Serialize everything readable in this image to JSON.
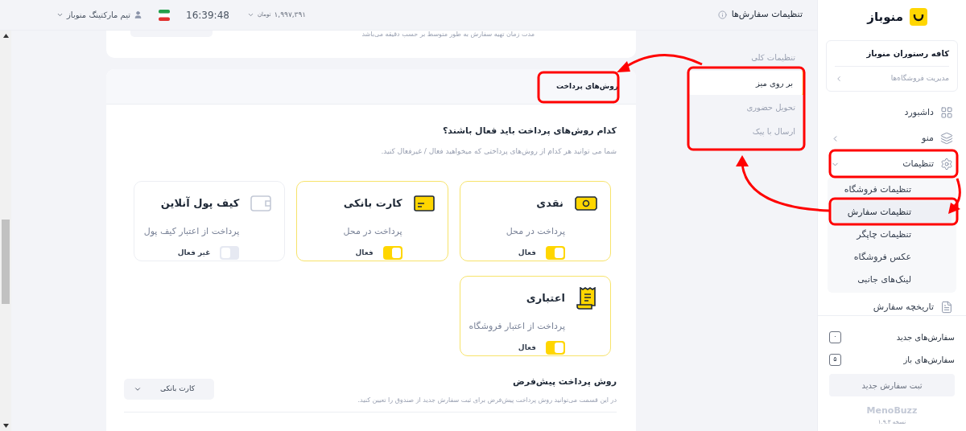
{
  "header": {
    "title": "تنظیمات سفارش‌ها",
    "balance": "۱,۹۹۷,۳۹۱",
    "currency": "تومان",
    "time": "16:39:48",
    "user": "تیم مارکتینگ منوباز"
  },
  "sidebar": {
    "brand": "منوباز",
    "store": {
      "name": "کافه رستوران منوباز",
      "link": "مدیریت فروشگاه‌ها"
    },
    "items": [
      {
        "label": "داشبورد",
        "kind": "grid"
      },
      {
        "label": "منو",
        "kind": "layers",
        "expanded": false
      },
      {
        "label": "تنظیمات",
        "kind": "gear",
        "expanded": true,
        "children": [
          {
            "label": "تنظیمات فروشگاه",
            "selected": false
          },
          {
            "label": "تنظیمات سفارش",
            "selected": true
          },
          {
            "label": "تنظیمات چاپگر",
            "selected": false
          },
          {
            "label": "عکس فروشگاه",
            "selected": false
          },
          {
            "label": "لینک‌های جانبی",
            "selected": false
          }
        ]
      },
      {
        "label": "تاریخچه سفارش",
        "kind": "list"
      }
    ],
    "counters": [
      {
        "label": "سفارش‌های جدید",
        "count": "۰"
      },
      {
        "label": "سفارش‌های باز",
        "count": "۵"
      }
    ],
    "new_order_button": "ثبت سفارش جدید",
    "footer_logo": "MenoBuzz",
    "version": "نسخه ۱.۹.۳"
  },
  "top_card": {
    "hint": "مدت زمان تهیه سفارش به طور متوسط بر حسب دقیقه می‌باشد"
  },
  "subnav": {
    "heading": "تنظیمات کلی",
    "items": [
      {
        "label": "بر روی میز",
        "selected": true
      },
      {
        "label": "تحویل حضوری",
        "selected": false
      },
      {
        "label": "ارسال با پیک",
        "selected": false
      }
    ]
  },
  "payment": {
    "tab": "روش‌های پرداخت",
    "question": "کدام روش‌های پرداخت باید فعال باشند؟",
    "description": "شما می توانید هر کدام از روش‌های پرداختی که میخواهید فعال / غیرفعال کنید.",
    "methods": [
      {
        "kind": "cash",
        "title": "نقدی",
        "subtitle": "پرداخت در محل",
        "on": true,
        "status": "فعال"
      },
      {
        "kind": "card",
        "title": "کارت بانکی",
        "subtitle": "پرداخت در محل",
        "on": true,
        "status": "فعال"
      },
      {
        "kind": "wallet",
        "title": "کیف پول آنلاین",
        "subtitle": "پرداخت از اعتبار کیف پول",
        "on": false,
        "status": "غیر فعال"
      },
      {
        "kind": "receipt",
        "title": "اعتباری",
        "subtitle": "پرداخت از اعتبار فروشگاه",
        "on": true,
        "status": "فعال"
      }
    ],
    "default": {
      "title": "روش پرداخت پیش‌فرض",
      "description": "در این قسمت می‌توانید روش پرداخت پیش‌فرض برای ثبت سفارش جدید از صندوق را تعیین کنید.",
      "value": "کارت بانکی"
    }
  }
}
